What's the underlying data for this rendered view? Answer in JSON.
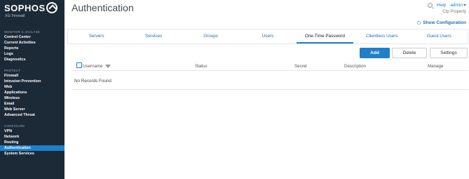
{
  "brand": {
    "name": "SOPHOS",
    "product": "XG Firewall"
  },
  "sidebar": {
    "sections": [
      {
        "title": "MONITOR & ANALYZE",
        "items": [
          "Control Center",
          "Current Activities",
          "Reports",
          "Logs",
          "Diagnostics"
        ]
      },
      {
        "title": "PROTECT",
        "items": [
          "Firewall",
          "Intrusion Prevention",
          "Web",
          "Applications",
          "Wireless",
          "Email",
          "Web Server",
          "Advanced Threat"
        ]
      },
      {
        "title": "CONFIGURE",
        "items": [
          "VPN",
          "Network",
          "Routing",
          "Authentication",
          "System Services"
        ]
      }
    ],
    "active_item": "Authentication"
  },
  "header": {
    "title": "Authentication",
    "help_label": "Help",
    "user_label": "admin",
    "device_name": "Ctp Property",
    "show_config_label": "Show Configuration"
  },
  "tabs": [
    {
      "label": "Servers",
      "active": false
    },
    {
      "label": "Services",
      "active": false
    },
    {
      "label": "Groups",
      "active": false
    },
    {
      "label": "Users",
      "active": false
    },
    {
      "label": "One-Time Password",
      "active": true
    },
    {
      "label": "Clientless Users",
      "active": false
    },
    {
      "label": "Guest Users",
      "active": false
    }
  ],
  "toolbar": {
    "add_label": "Add",
    "delete_label": "Delete",
    "settings_label": "Settings"
  },
  "table": {
    "columns": [
      "Username",
      "Status",
      "Secret",
      "Description",
      "Manage"
    ],
    "empty_message": "No Records Found"
  },
  "colors": {
    "accent": "#1f7fc9",
    "sidebar_bg": "#1c2a38",
    "link": "#1e6fb8"
  }
}
